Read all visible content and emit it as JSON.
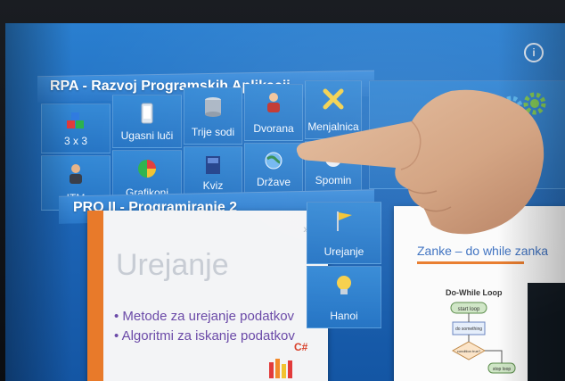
{
  "screen": {
    "info_icon": "i",
    "rpa": {
      "title": "RPA - Razvoj Programskih Aplikacij",
      "tiles": [
        {
          "label": "3 x 3",
          "icon": "cubes-icon"
        },
        {
          "label": "Ugasni luči",
          "icon": "phone-icon"
        },
        {
          "label": "Trije sodi",
          "icon": "barrels-icon"
        },
        {
          "label": "Dvorana",
          "icon": "person-icon"
        },
        {
          "label": "Menjalnica",
          "icon": "cross-tools-icon"
        },
        {
          "label": "ITM",
          "icon": "person-icon"
        },
        {
          "label": "Grafikoni",
          "icon": "pie-chart-icon"
        },
        {
          "label": "Kviz",
          "icon": "book-icon"
        },
        {
          "label": "Države",
          "icon": "globe-icon"
        },
        {
          "label": "Spomin",
          "icon": "memory-icon"
        }
      ]
    },
    "pro2": {
      "title": "PRO II - Programiranje 2",
      "preview": {
        "heading": "Urejanje",
        "bullets": [
          "Metode za urejanje podatkov",
          "Algoritmi za iskanje podatkov"
        ],
        "chevrons": "›››",
        "badge": "C#"
      },
      "tiles": [
        {
          "label": "Urejanje",
          "icon": "flag-icon"
        },
        {
          "label": "Hanoi",
          "icon": "bulb-icon"
        }
      ]
    },
    "right_preview": {
      "title": "Zanke – do while zanka",
      "diagram_title": "Do-While Loop",
      "flow_labels": [
        "start loop",
        "do something",
        "condition true?",
        "stop loop"
      ]
    }
  },
  "colors": {
    "screen_top": "#2a7fd0",
    "screen_bottom": "#1456a4",
    "accent_orange": "#e87a2a",
    "text_purple": "#6b4aa8"
  }
}
